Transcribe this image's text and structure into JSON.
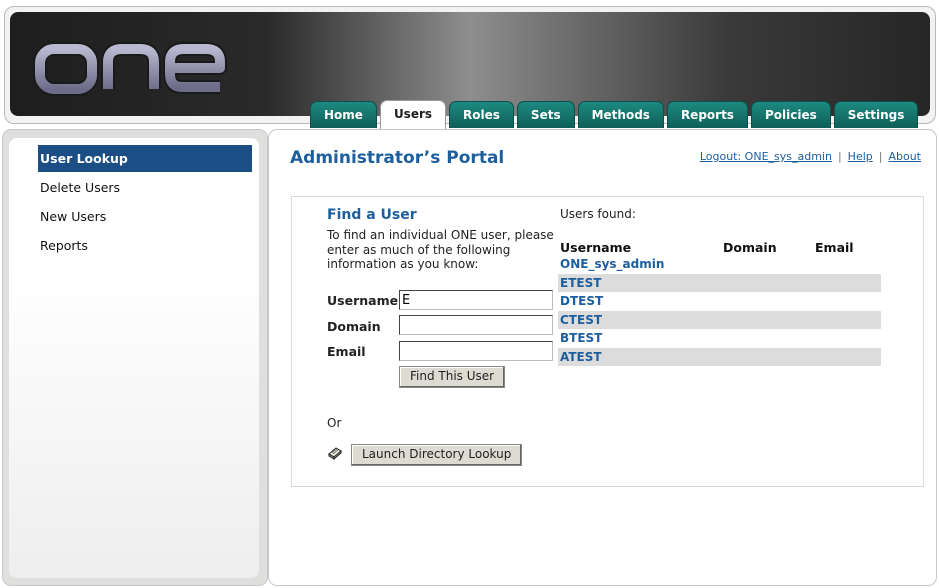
{
  "app": {
    "logo_text": "ONE"
  },
  "tabs": [
    {
      "label": "Home",
      "active": false
    },
    {
      "label": "Users",
      "active": true
    },
    {
      "label": "Roles",
      "active": false
    },
    {
      "label": "Sets",
      "active": false
    },
    {
      "label": "Methods",
      "active": false
    },
    {
      "label": "Reports",
      "active": false
    },
    {
      "label": "Policies",
      "active": false
    },
    {
      "label": "Settings",
      "active": false
    }
  ],
  "sidebar": {
    "items": [
      {
        "label": "User Lookup",
        "active": true
      },
      {
        "label": "Delete Users",
        "active": false
      },
      {
        "label": "New Users",
        "active": false
      },
      {
        "label": "Reports",
        "active": false
      }
    ]
  },
  "header": {
    "title": "Administrator’s Portal",
    "logout_label": "Logout: ONE_sys_admin",
    "help_label": "Help",
    "about_label": "About"
  },
  "find": {
    "title": "Find a User",
    "instructions": "To find an individual ONE user, please enter as much of the following information as you know:",
    "username_label": "Username",
    "username_value": "E",
    "domain_label": "Domain",
    "domain_value": "",
    "email_label": "Email",
    "email_value": "",
    "button_label": "Find This User",
    "or_text": "Or",
    "directory_button_label": "Launch Directory Lookup"
  },
  "results": {
    "label": "Users found:",
    "columns": [
      "Username",
      "Domain",
      "Email"
    ],
    "rows": [
      "ONE_sys_admin",
      "ETEST",
      "DTEST",
      "CTEST",
      "BTEST",
      "ATEST"
    ]
  },
  "colors": {
    "tab": "#0e6b63",
    "accent": "#1d5e9e",
    "sidebar_active": "#1b4e85"
  }
}
